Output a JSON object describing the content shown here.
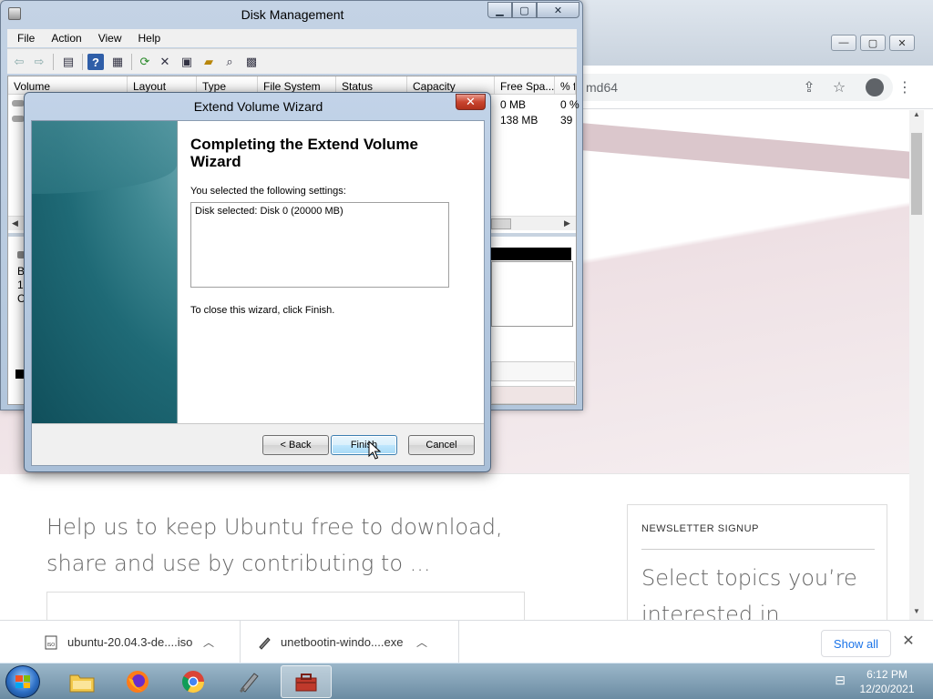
{
  "browser": {
    "url_fragment": "md64",
    "donate_heading": "Help us to keep Ubuntu free to download, share and use by contributing to ...",
    "newsletter_label": "NEWSLETTER SIGNUP",
    "newsletter_text": "Select topics you’re interested in",
    "downloads": [
      {
        "name": "ubuntu-20.04.3-de....iso",
        "icon": "iso-file-icon"
      },
      {
        "name": "unetbootin-windo....exe",
        "icon": "exe-file-icon"
      }
    ],
    "show_all": "Show all"
  },
  "disk_management": {
    "title": "Disk Management",
    "menu": [
      "File",
      "Action",
      "View",
      "Help"
    ],
    "columns": [
      "Volume",
      "Layout",
      "Type",
      "File System",
      "Status",
      "Capacity",
      "Free Spa...",
      "% f"
    ],
    "rows": [
      {
        "free_space": "0 MB",
        "pct_free": "0 %"
      },
      {
        "free_space": "138 MB",
        "pct_free": "39"
      }
    ],
    "side_labels": [
      "B",
      "1(",
      "C"
    ]
  },
  "wizard": {
    "title": "Extend Volume Wizard",
    "heading": "Completing the Extend Volume Wizard",
    "settings_label": "You selected the following settings:",
    "settings_text": "Disk selected: Disk 0 (20000 MB)",
    "close_instructions": "To close this wizard, click Finish.",
    "back_label": "< Back",
    "finish_label": "Finish",
    "cancel_label": "Cancel"
  },
  "taskbar": {
    "time": "6:12 PM",
    "date": "12/20/2021"
  }
}
